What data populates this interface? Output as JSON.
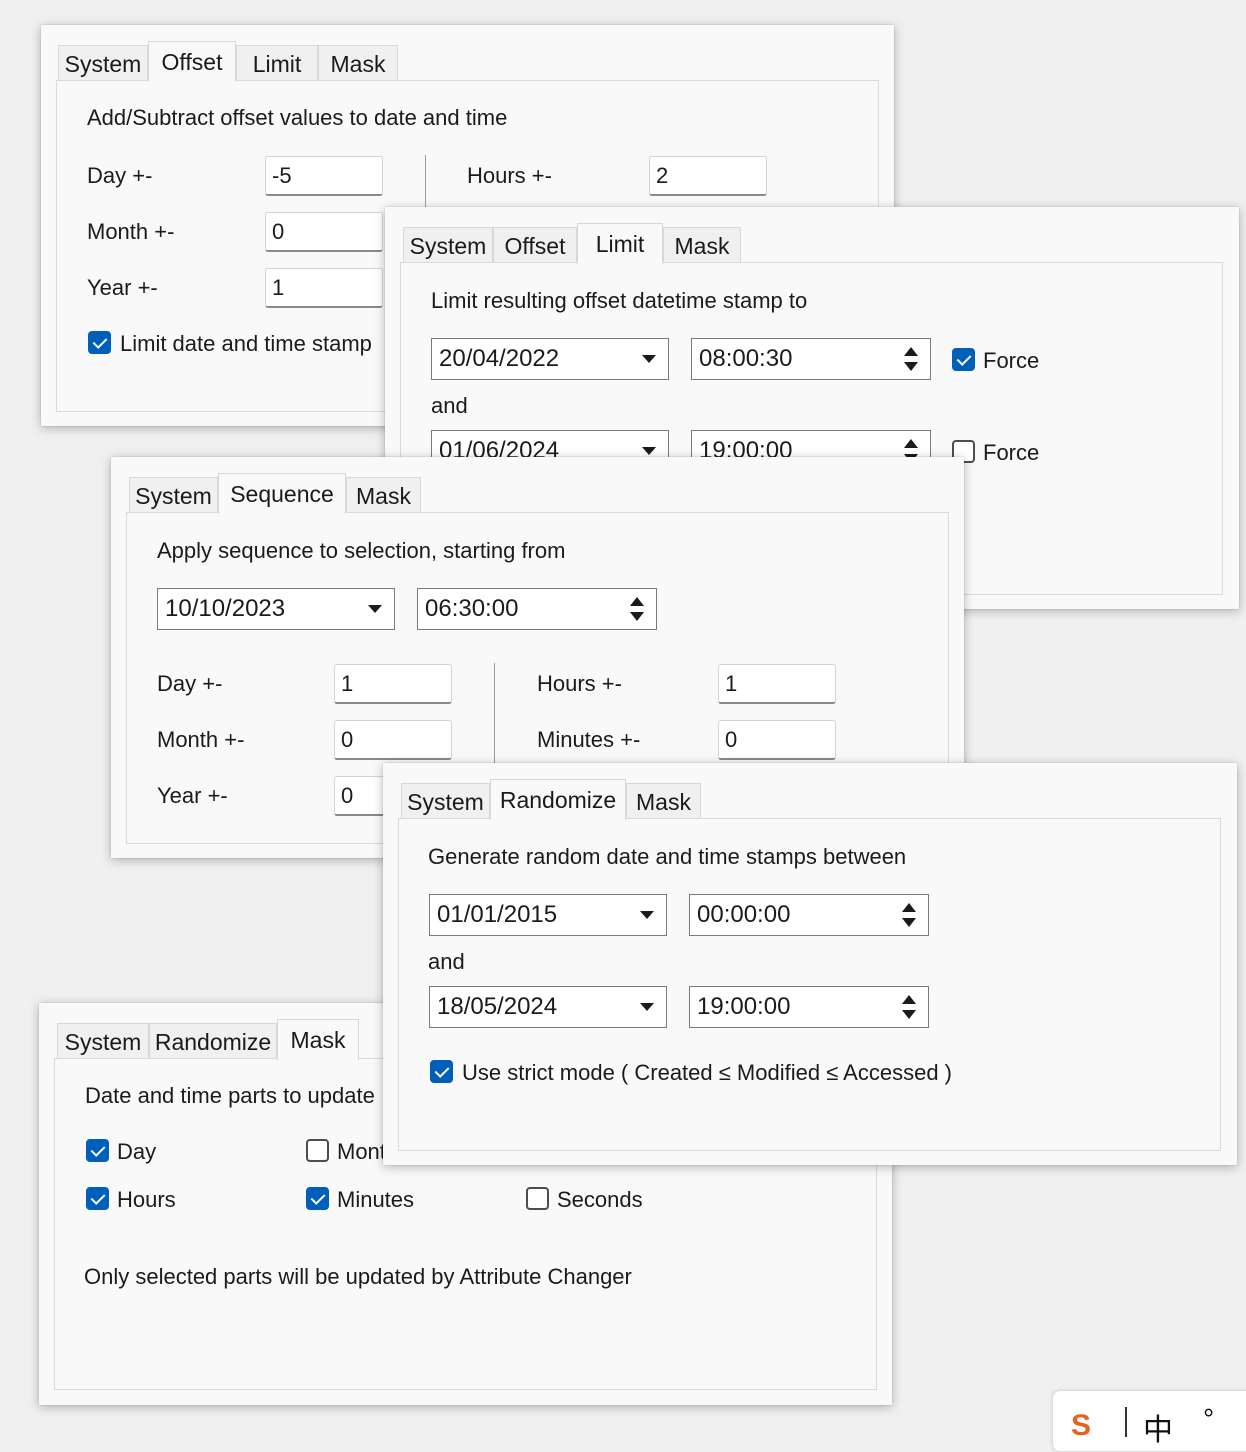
{
  "offset_panel": {
    "tabs": [
      "System",
      "Offset",
      "Limit",
      "Mask"
    ],
    "active_tab": "Offset",
    "heading": "Add/Subtract offset values to date and time",
    "day_label": "Day +-",
    "day_value": "-5",
    "month_label": "Month +-",
    "month_value": "0",
    "year_label": "Year +-",
    "year_value": "1",
    "hours_label": "Hours +-",
    "hours_value": "2",
    "limit_checkbox_label": "Limit date and time stamp",
    "limit_checked": true
  },
  "limit_panel": {
    "tabs": [
      "System",
      "Offset",
      "Limit",
      "Mask"
    ],
    "active_tab": "Limit",
    "heading": "Limit resulting offset datetime stamp to",
    "from_date": "20/04/2022",
    "from_time": "08:00:30",
    "from_force_label": "Force",
    "from_force_checked": true,
    "and_label": "and",
    "to_date": "01/06/2024",
    "to_time": "19:00:00",
    "to_force_label": "Force",
    "to_force_checked": false
  },
  "sequence_panel": {
    "tabs": [
      "System",
      "Sequence",
      "Mask"
    ],
    "active_tab": "Sequence",
    "heading": "Apply sequence to selection, starting from",
    "start_date": "10/10/2023",
    "start_time": "06:30:00",
    "day_label": "Day +-",
    "day_value": "1",
    "month_label": "Month +-",
    "month_value": "0",
    "year_label": "Year +-",
    "year_value": "0",
    "hours_label": "Hours +-",
    "hours_value": "1",
    "minutes_label": "Minutes +-",
    "minutes_value": "0"
  },
  "randomize_panel": {
    "tabs": [
      "System",
      "Randomize",
      "Mask"
    ],
    "active_tab": "Randomize",
    "heading": "Generate random date and time stamps between",
    "from_date": "01/01/2015",
    "from_time": "00:00:00",
    "and_label": "and",
    "to_date": "18/05/2024",
    "to_time": "19:00:00",
    "strict_label": "Use strict mode ( Created ≤ Modified ≤ Accessed )",
    "strict_checked": true
  },
  "mask_panel": {
    "tabs": [
      "System",
      "Randomize",
      "Mask"
    ],
    "active_tab": "Mask",
    "heading": "Date and time parts to update",
    "day_label": "Day",
    "day_checked": true,
    "month_label": "Mont",
    "month_checked": false,
    "hours_label": "Hours",
    "hours_checked": true,
    "minutes_label": "Minutes",
    "minutes_checked": true,
    "seconds_label": "Seconds",
    "seconds_checked": false,
    "footer": "Only selected parts will be updated by Attribute Changer"
  },
  "tray": {
    "logo": "S",
    "glyph1": "中",
    "glyph2": "°"
  },
  "colors": {
    "accent": "#005fb8",
    "panel_bg": "#f9f9f9",
    "page_bg": "#f0f0f0"
  }
}
